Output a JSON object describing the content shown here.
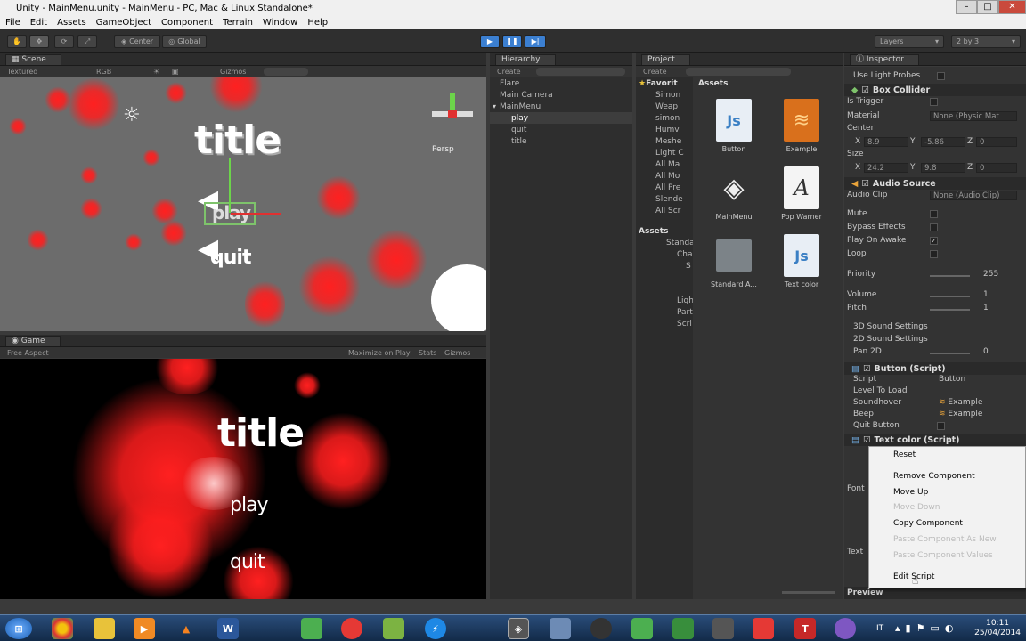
{
  "window": {
    "title": "Unity - MainMenu.unity - MainMenu - PC, Mac & Linux Standalone*"
  },
  "menu": [
    "File",
    "Edit",
    "Assets",
    "GameObject",
    "Component",
    "Terrain",
    "Window",
    "Help"
  ],
  "toolbar": {
    "center": "Center",
    "global": "Global",
    "layers": "Layers",
    "layout": "2 by 3"
  },
  "scene": {
    "tab": "Scene",
    "mode": "Textured",
    "rgb": "RGB",
    "gizmos": "Gizmos",
    "persp": "Persp",
    "title_text": "title",
    "play_text": "play",
    "quit_text": "quit"
  },
  "game": {
    "tab": "Game",
    "aspect": "Free Aspect",
    "maximize": "Maximize on Play",
    "stats": "Stats",
    "gizmos": "Gizmos",
    "title_text": "title",
    "play_text": "play",
    "quit_text": "quit"
  },
  "hierarchy": {
    "tab": "Hierarchy",
    "create": "Create",
    "items": [
      "Flare",
      "Main Camera",
      "MainMenu",
      "play",
      "quit",
      "title"
    ]
  },
  "project": {
    "tab": "Project",
    "create": "Create",
    "favorites": "Favorit",
    "assets_header": "Assets",
    "favorites_items": [
      "Simon",
      "Weap",
      "simon",
      "Humv",
      "Meshe",
      "Light C",
      "All Ma",
      "All Mo",
      "All Pre",
      "Slende",
      "All Scr"
    ],
    "tree_assets": "Assets",
    "tree_items": [
      "Standa",
      "Cha",
      "S",
      "",
      "",
      "Ligh",
      "Part",
      "Scri"
    ],
    "assets": [
      {
        "name": "Button",
        "icon": "js-file-icon"
      },
      {
        "name": "Example",
        "icon": "audio-file-icon"
      },
      {
        "name": "MainMenu",
        "icon": "unity-scene-icon"
      },
      {
        "name": "Pop Warner",
        "icon": "font-file-icon"
      },
      {
        "name": "Standard A...",
        "icon": "folder-icon"
      },
      {
        "name": "Text color",
        "icon": "js-file-icon"
      }
    ]
  },
  "inspector": {
    "tab": "Inspector",
    "top_label": "Use Light Probes",
    "box_collider": {
      "title": "Box Collider",
      "is_trigger": "Is Trigger",
      "material": "Material",
      "material_val": "None (Physic Mat",
      "center": "Center",
      "cx": "8.9",
      "cy": "-5.86",
      "cz": "0",
      "size": "Size",
      "sx": "24.2",
      "sy": "9.8",
      "sz": "0",
      "x": "X",
      "y": "Y",
      "z": "Z"
    },
    "audio_source": {
      "title": "Audio Source",
      "clip": "Audio Clip",
      "clip_val": "None (Audio Clip)",
      "mute": "Mute",
      "bypass": "Bypass Effects",
      "play_on_awake": "Play On Awake",
      "loop": "Loop",
      "priority": "Priority",
      "priority_val": "255",
      "volume": "Volume",
      "volume_val": "1",
      "pitch": "Pitch",
      "pitch_val": "1",
      "s3d": "3D Sound Settings",
      "s2d": "2D Sound Settings",
      "pan": "Pan 2D",
      "pan_val": "0"
    },
    "button_script": {
      "title": "Button (Script)",
      "script": "Script",
      "script_val": "Button",
      "level": "Level To Load",
      "soundhover": "Soundhover",
      "soundhover_val": "Example",
      "beep": "Beep",
      "beep_val": "Example",
      "quit": "Quit Button"
    },
    "text_color": {
      "title": "Text color (Script)",
      "font": "Font",
      "text": "Text"
    },
    "preview": "Preview"
  },
  "context_menu": [
    {
      "label": "Reset",
      "enabled": true
    },
    {
      "label": "Remove Component",
      "enabled": true
    },
    {
      "label": "Move Up",
      "enabled": true
    },
    {
      "label": "Move Down",
      "enabled": false
    },
    {
      "label": "Copy Component",
      "enabled": true
    },
    {
      "label": "Paste Component As New",
      "enabled": false
    },
    {
      "label": "Paste Component Values",
      "enabled": false
    },
    {
      "label": "Edit Script",
      "enabled": true
    }
  ],
  "taskbar": {
    "lang": "IT",
    "time": "10:11",
    "date": "25/04/2014"
  }
}
